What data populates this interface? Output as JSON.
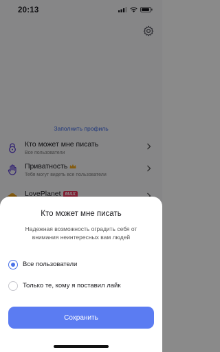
{
  "status_bar": {
    "time": "20:13"
  },
  "profile": {
    "fill_profile_link": "Заполнить профиль"
  },
  "settings": [
    {
      "title": "Кто может мне писать",
      "subtitle": "Все пользователи",
      "icon": "lock-chat-icon"
    },
    {
      "title": "Приватность",
      "subtitle": "Тебя могут видеть все пользователи",
      "icon": "hand-icon",
      "badge": "crown-icon"
    },
    {
      "title": "LovePlanet",
      "subtitle": "",
      "icon": "planet-icon",
      "badge_text": "MAX"
    }
  ],
  "sheet": {
    "title": "Кто может мне писать",
    "description": "Надежная возможность оградить себя от внимания неинтересных вам людей",
    "options": [
      {
        "label": "Все пользователи",
        "selected": true
      },
      {
        "label": "Только те, кому я поставил лайк",
        "selected": false
      }
    ],
    "save_label": "Сохранить"
  },
  "colors": {
    "accent": "#5b7cf2",
    "link": "#3a64e0",
    "badge": "#e8355a"
  }
}
